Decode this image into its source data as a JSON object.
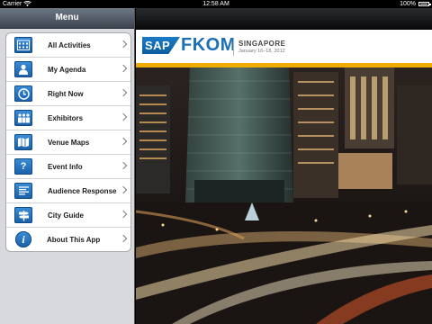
{
  "status_bar": {
    "carrier": "Carrier",
    "time": "12:58 AM",
    "battery": "100%",
    "battery_level": 1.0
  },
  "sidebar": {
    "title": "Menu",
    "items": [
      {
        "label": "All Activities",
        "icon": "calendar-icon"
      },
      {
        "label": "My Agenda",
        "icon": "person-icon"
      },
      {
        "label": "Right Now",
        "icon": "clock-icon"
      },
      {
        "label": "Exhibitors",
        "icon": "exhibitors-icon"
      },
      {
        "label": "Venue Maps",
        "icon": "map-icon"
      },
      {
        "label": "Event Info",
        "icon": "question-icon"
      },
      {
        "label": "Audience Response",
        "icon": "document-icon"
      },
      {
        "label": "City Guide",
        "icon": "signpost-icon"
      },
      {
        "label": "About This App",
        "icon": "info-icon"
      }
    ]
  },
  "banner": {
    "logo": "SAP",
    "event": "FKOM",
    "city": "SINGAPORE",
    "dates": "January 16–18, 2012",
    "accent": "#f0ab00",
    "brand": "#1a6fb5"
  }
}
